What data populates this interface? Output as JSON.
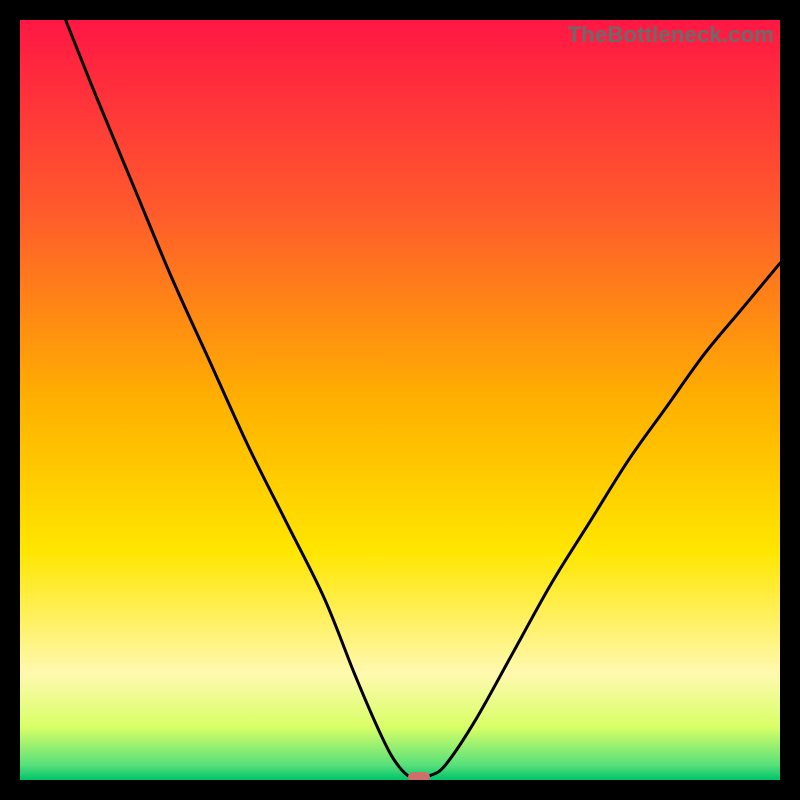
{
  "watermark": {
    "text": "TheBottleneck.com"
  },
  "colors": {
    "frame": "#000000",
    "gradient_stops": [
      {
        "pos": 0.0,
        "color": "#ff1744"
      },
      {
        "pos": 0.25,
        "color": "#ff5a2c"
      },
      {
        "pos": 0.5,
        "color": "#ffb000"
      },
      {
        "pos": 0.7,
        "color": "#ffe600"
      },
      {
        "pos": 0.86,
        "color": "#fff9b0"
      },
      {
        "pos": 0.93,
        "color": "#d9ff66"
      },
      {
        "pos": 0.98,
        "color": "#58e07a"
      },
      {
        "pos": 1.0,
        "color": "#00c46a"
      }
    ],
    "curve": "#000000",
    "marker": "#cf6f6a"
  },
  "chart_data": {
    "type": "line",
    "title": "",
    "xlabel": "",
    "ylabel": "",
    "xlim": [
      0,
      100
    ],
    "ylim": [
      0,
      100
    ],
    "series": [
      {
        "name": "bottleneck-curve",
        "x": [
          6,
          10,
          15,
          20,
          25,
          30,
          35,
          40,
          44,
          47,
          49,
          51,
          52.5,
          54,
          56,
          60,
          65,
          70,
          75,
          80,
          85,
          90,
          95,
          100
        ],
        "y": [
          100,
          90,
          78,
          66,
          55,
          44,
          34,
          24,
          14,
          7,
          3,
          0.6,
          0.4,
          0.6,
          2,
          8,
          17,
          26,
          34,
          42,
          49,
          56,
          62,
          68
        ]
      }
    ],
    "marker": {
      "x": 52.5,
      "y": 0.4
    },
    "grid": false,
    "legend": false
  }
}
